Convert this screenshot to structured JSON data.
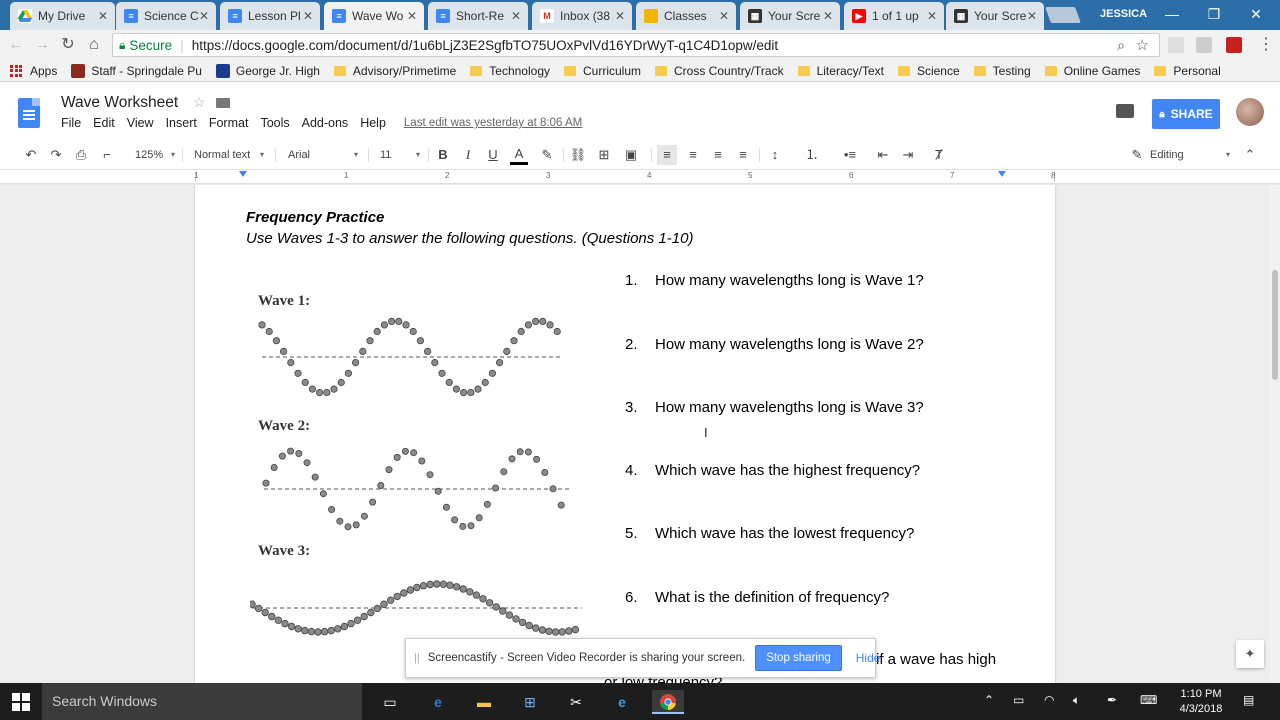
{
  "browser": {
    "tabs": [
      {
        "label": "My Drive",
        "icon": "drive-icon"
      },
      {
        "label": "Science C",
        "icon": "docs-icon"
      },
      {
        "label": "Lesson Pl",
        "icon": "docs-icon"
      },
      {
        "label": "Wave Wo",
        "icon": "docs-icon",
        "active": true
      },
      {
        "label": "Short-Re",
        "icon": "docs-icon"
      },
      {
        "label": "Inbox (38",
        "icon": "gmail-icon"
      },
      {
        "label": "Classes",
        "icon": "classroom-icon"
      },
      {
        "label": "Your Scre",
        "icon": "screencastify-icon"
      },
      {
        "label": "1 of 1 up",
        "icon": "youtube-icon"
      },
      {
        "label": "Your Scre",
        "icon": "screencastify-icon"
      }
    ],
    "profile_name": "JESSICA",
    "secure_label": "Secure",
    "url": "https://docs.google.com/document/d/1u6bLjZ3E2SgfbTO75UOxPvlVd16YDrWyT-q1C4D1opw/edit",
    "bookmarks": [
      {
        "label": "Apps",
        "kind": "apps"
      },
      {
        "label": "Staff - Springdale Pu",
        "kind": "logo",
        "color": "#8b2a1c"
      },
      {
        "label": "George Jr. High",
        "kind": "logo",
        "color": "#1a3c8c"
      },
      {
        "label": "Advisory/Primetime",
        "kind": "folder"
      },
      {
        "label": "Technology",
        "kind": "folder"
      },
      {
        "label": "Curriculum",
        "kind": "folder"
      },
      {
        "label": "Cross Country/Track",
        "kind": "folder"
      },
      {
        "label": "Literacy/Text",
        "kind": "folder"
      },
      {
        "label": "Science",
        "kind": "folder"
      },
      {
        "label": "Testing",
        "kind": "folder"
      },
      {
        "label": "Online Games",
        "kind": "folder"
      },
      {
        "label": "Personal",
        "kind": "folder"
      }
    ]
  },
  "docs": {
    "title": "Wave Worksheet",
    "menus": [
      "File",
      "Edit",
      "View",
      "Insert",
      "Format",
      "Tools",
      "Add-ons",
      "Help"
    ],
    "last_edit": "Last edit was yesterday at 8:06 AM",
    "share_label": "SHARE",
    "toolbar": {
      "zoom": "125%",
      "style": "Normal text",
      "font": "Arial",
      "size": "11",
      "mode": "Editing"
    },
    "ruler_numbers": [
      "1",
      "1",
      "2",
      "3",
      "4",
      "5",
      "6",
      "7",
      "8"
    ]
  },
  "document": {
    "heading": "Frequency Practice",
    "instructions": "Use Waves 1-3 to answer the following questions. (Questions 1-10)",
    "wave_labels": [
      "Wave 1:",
      "Wave 2:",
      "Wave 3:"
    ],
    "questions": [
      {
        "num": "1.",
        "text": "How many wavelengths long is Wave 1?"
      },
      {
        "num": "2.",
        "text": "How many wavelengths long is Wave 2?"
      },
      {
        "num": "3.",
        "text": "How many wavelengths long is Wave 3?"
      },
      {
        "num": "4.",
        "text": "Which wave has the highest frequency?"
      },
      {
        "num": "5.",
        "text": "Which wave has the lowest frequency?"
      },
      {
        "num": "6.",
        "text": "What is the definition of frequency?"
      }
    ],
    "q7_visible_tail": "if a wave has high",
    "q7_wrap": "or low frequency?"
  },
  "screencastify": {
    "message": "Screencastify - Screen Video Recorder is sharing your screen.",
    "stop_label": "Stop sharing",
    "hide_label": "Hide"
  },
  "taskbar": {
    "search_placeholder": "Search Windows",
    "time": "1:10 PM",
    "date": "4/3/2018"
  },
  "colors": {
    "accent": "#4285f4",
    "secure_green": "#0b8043",
    "tabstrip": "#2b6ea8"
  }
}
